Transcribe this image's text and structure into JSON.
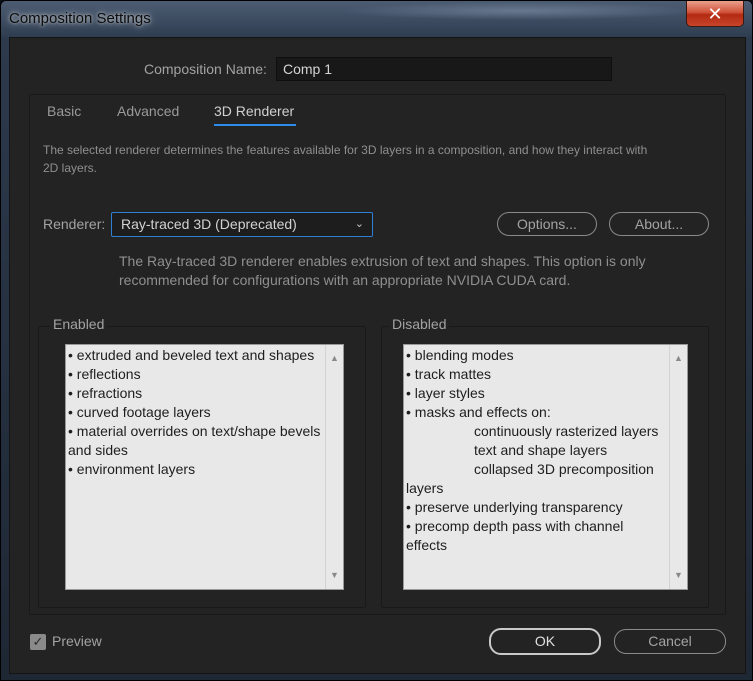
{
  "window": {
    "title": "Composition Settings",
    "close_label": "✕"
  },
  "composition_name": {
    "label": "Composition Name:",
    "value": "Comp 1"
  },
  "tabs": [
    {
      "label": "Basic",
      "active": false
    },
    {
      "label": "Advanced",
      "active": false
    },
    {
      "label": "3D Renderer",
      "active": true
    }
  ],
  "renderer_panel": {
    "description": [
      "The selected renderer determines the features available for 3D layers in a composition, and how they interact with",
      "2D layers."
    ],
    "renderer_label": "Renderer:",
    "renderer_value": "Ray-traced 3D (Deprecated)",
    "options_label": "Options...",
    "about_label": "About...",
    "renderer_info": [
      "The Ray-traced 3D renderer enables extrusion of text and shapes. This option is only",
      "recommended for configurations with an appropriate NVIDIA CUDA card."
    ]
  },
  "enabled": {
    "title": "Enabled",
    "lines": [
      "• extruded and beveled text and shapes",
      "• reflections",
      "• refractions",
      "• curved footage layers",
      "• material overrides on text/shape bevels",
      "and sides",
      "• environment layers"
    ]
  },
  "disabled": {
    "title": "Disabled",
    "lines": [
      "• blending modes",
      "• track mattes",
      "• layer styles",
      "• masks and effects on:",
      "continuously rasterized layers",
      "text and shape layers",
      "collapsed 3D precomposition",
      "layers",
      "• preserve underlying transparency",
      "• precomp depth pass with channel",
      "effects"
    ]
  },
  "footer": {
    "preview_label": "Preview",
    "preview_checked": true,
    "ok_label": "OK",
    "cancel_label": "Cancel"
  },
  "colors": {
    "accent": "#2d8ceb",
    "dialog_bg": "#232323"
  }
}
